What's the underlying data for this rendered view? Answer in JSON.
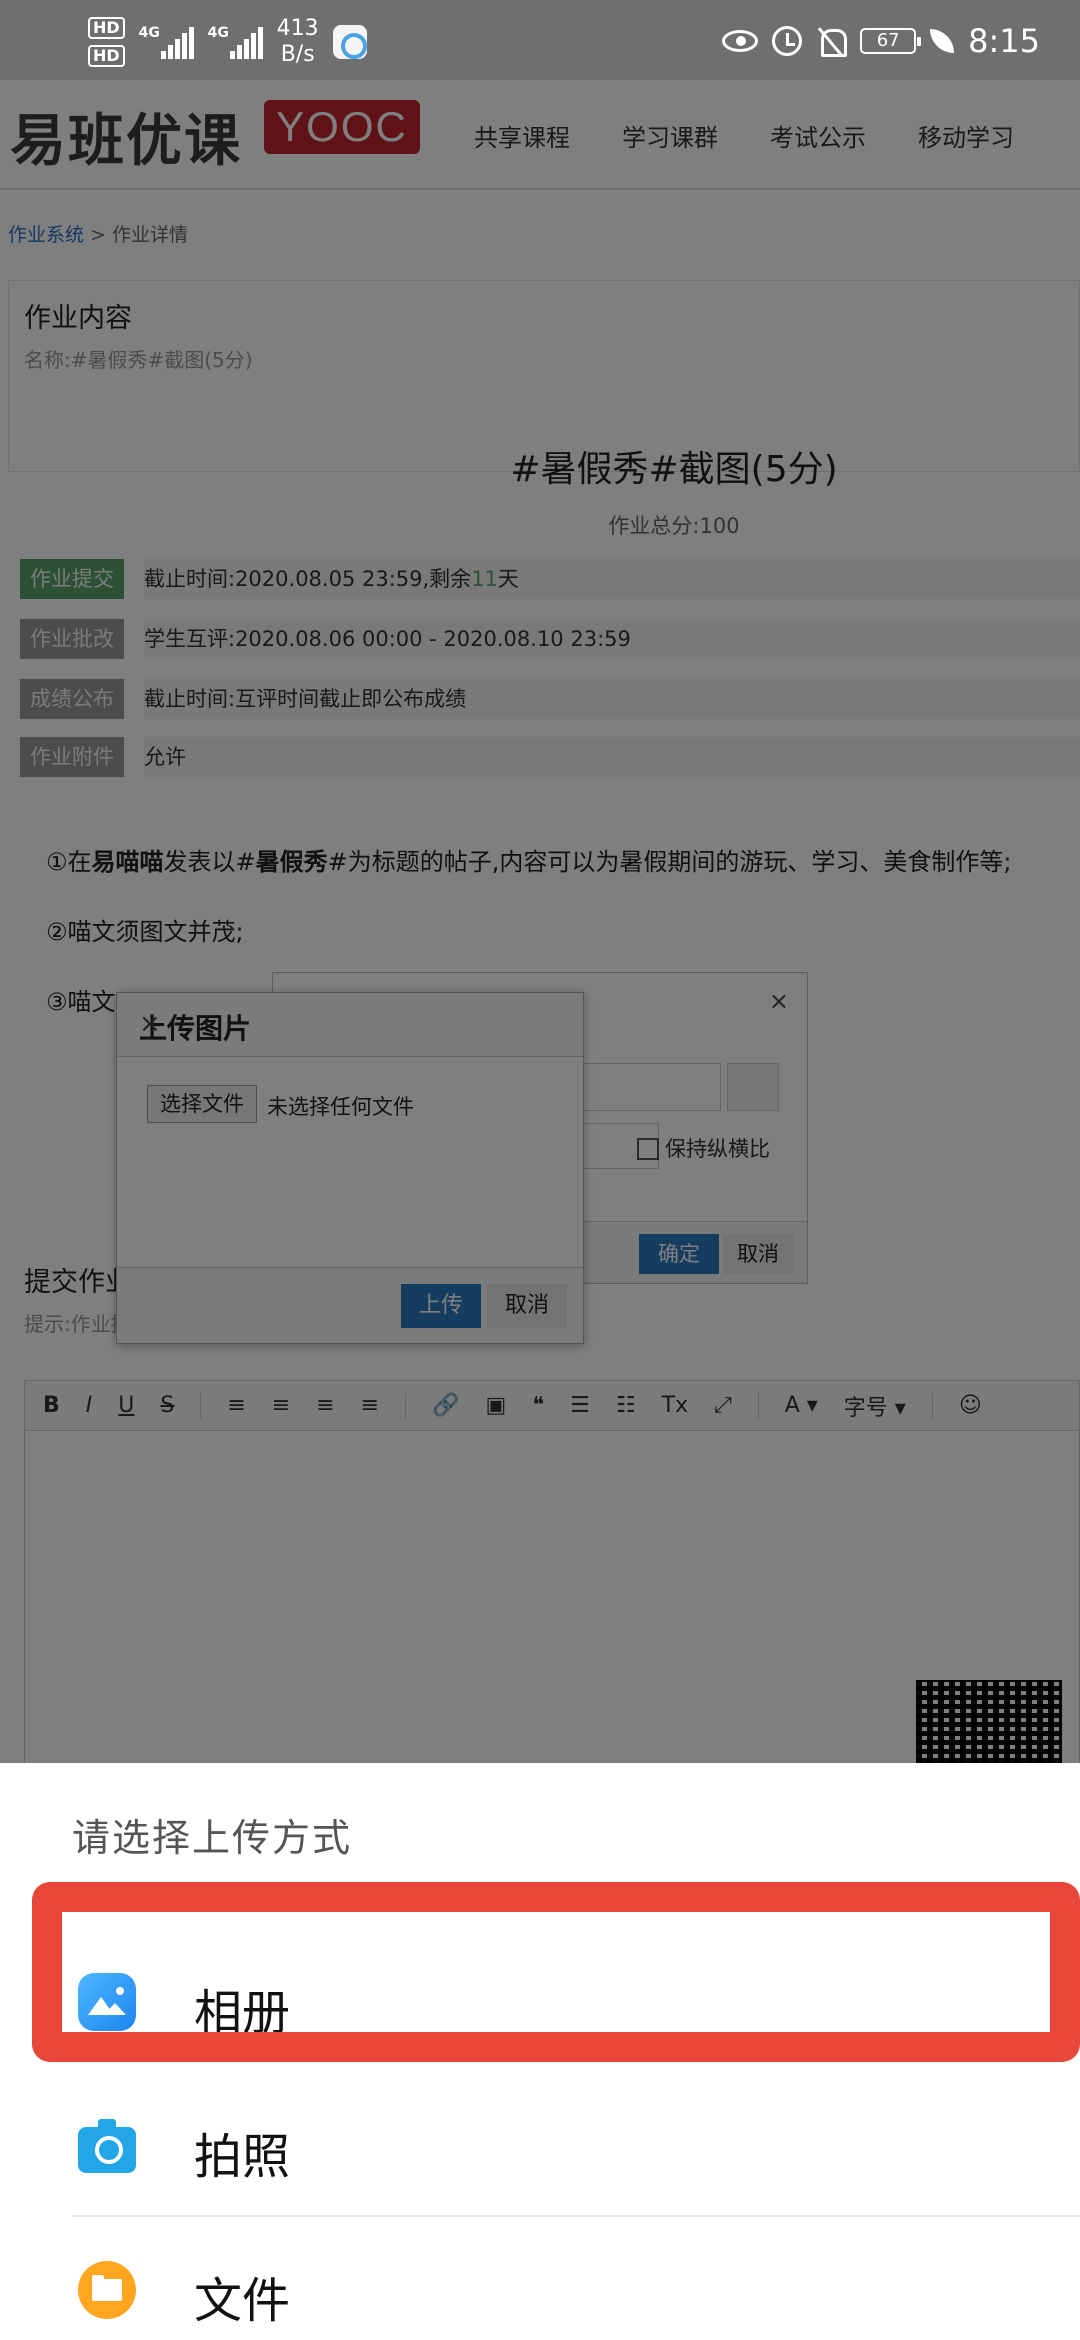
{
  "status_bar": {
    "hd1": "HD",
    "hd2": "HD",
    "sig1_label": "4G",
    "sig2_label": "4G",
    "net_speed_value": "413",
    "net_speed_unit": "B/s",
    "battery": "67",
    "time": "8:15"
  },
  "web": {
    "logo_cn": "易班优课",
    "logo_en": "YOOC",
    "nav": [
      "共享课程",
      "学习课群",
      "考试公示",
      "移动学习"
    ],
    "breadcrumb": {
      "root": "作业系统",
      "sep": ">",
      "current": "作业详情"
    },
    "content_section": {
      "title": "作业内容",
      "name": "名称:#暑假秀#截图(5分)"
    },
    "homework": {
      "title": "#暑假秀#截图(5分)",
      "total": "作业总分:100",
      "rows": [
        {
          "badge": "作业提交",
          "text_pre": "截止时间:2020.08.05 23:59,剩余",
          "highlight": "11",
          "text_post": "天"
        },
        {
          "badge": "作业批改",
          "text": "学生互评:2020.08.06 00:00 - 2020.08.10 23:59"
        },
        {
          "badge": "成绩公布",
          "text": "截止时间:互评时间截止即公布成绩"
        },
        {
          "badge": "作业附件",
          "text": "允许"
        }
      ]
    },
    "requirements": {
      "r1_a": "①在",
      "r1_b": "易喵喵",
      "r1_c": "发表以#",
      "r1_d": "暑假秀",
      "r1_e": "#为标题的帖子,内容可以为暑假期间的游玩、学习、美食制作等;",
      "r2": "②喵文须图文并茂;",
      "r3": "③喵文"
    },
    "submit_section": {
      "title": "提交作业",
      "tip": "提示:作业提交阶段,作业可重复提交,且仅保存最新提交的作业"
    },
    "toolbar": [
      "B",
      "I",
      "U",
      "S",
      "≡",
      "≡",
      "≡",
      "≡",
      "🔗",
      "▣",
      "❝",
      "☰",
      "☷",
      "Tx",
      "⤢",
      "A ▾",
      "字号 ▾",
      "☺"
    ],
    "edit_dialog": {
      "keep_ratio": "保持纵横比",
      "ok": "确定",
      "cancel": "取消",
      "close": "×"
    },
    "upload_dialog": {
      "title": "上传图片",
      "close": "×",
      "choose_file": "选择文件",
      "no_file": "未选择任何文件",
      "upload": "上传",
      "cancel": "取消"
    }
  },
  "sheet": {
    "title": "请选择上传方式",
    "options": [
      {
        "label": "相册",
        "icon": "album-icon"
      },
      {
        "label": "拍照",
        "icon": "camera-icon"
      },
      {
        "label": "文件",
        "icon": "file-icon"
      }
    ]
  },
  "colors": {
    "highlight": "#e8473a",
    "primary": "#2b7bc0",
    "brand": "#c1272d",
    "active_badge": "#5aa36b"
  }
}
